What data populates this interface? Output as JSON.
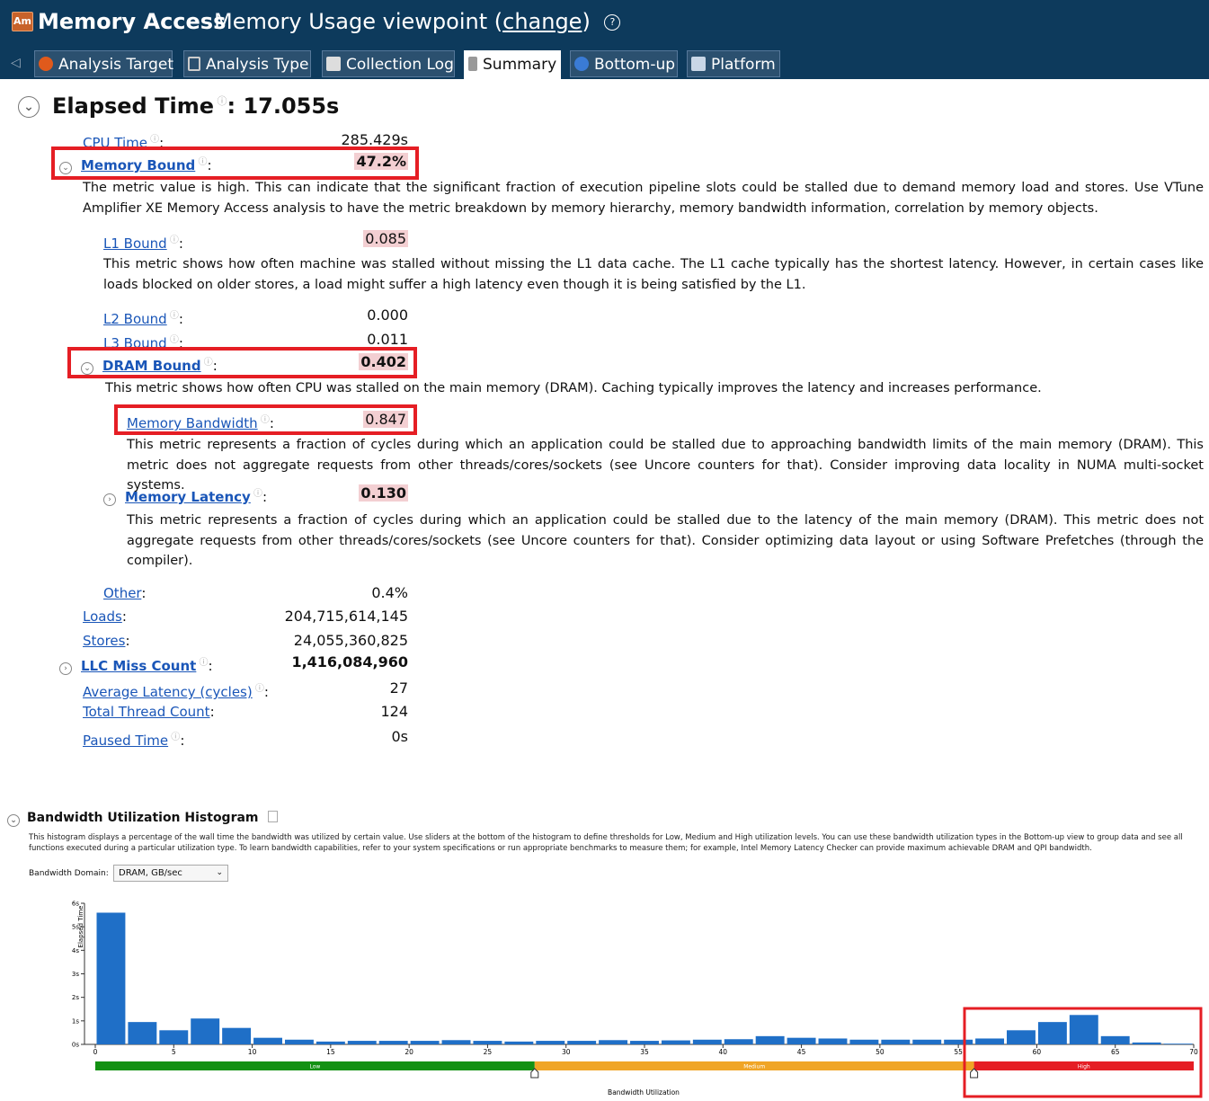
{
  "header": {
    "app_badge": "Am",
    "title": "Memory Access",
    "viewpoint": "Memory Usage viewpoint",
    "change_link": "change",
    "help": "?"
  },
  "tabs": [
    {
      "label": "Analysis Target",
      "icon": "target-icon",
      "active": false
    },
    {
      "label": "Analysis Type",
      "icon": "analysis-type-icon",
      "active": false
    },
    {
      "label": "Collection Log",
      "icon": "log-icon",
      "active": false
    },
    {
      "label": "Summary",
      "icon": "summary-icon",
      "active": true
    },
    {
      "label": "Bottom-up",
      "icon": "bottom-up-icon",
      "active": false
    },
    {
      "label": "Platform",
      "icon": "platform-icon",
      "active": false
    }
  ],
  "summary": {
    "elapsed_label": "Elapsed Time",
    "elapsed_value": ": 17.055s",
    "metrics": {
      "cpu_time": {
        "label": "CPU Time",
        "value": "285.429s"
      },
      "memory_bound": {
        "label": "Memory Bound",
        "value": "47.2%",
        "desc": "The metric value is high. This can indicate that the significant fraction of execution pipeline slots could be stalled due to demand memory load and stores. Use VTune Amplifier XE Memory Access analysis to have the metric breakdown by memory hierarchy, memory bandwidth information, correlation by memory objects."
      },
      "l1_bound": {
        "label": "L1 Bound",
        "value": "0.085",
        "desc": "This metric shows how often machine was stalled without missing the L1 data cache. The L1 cache typically has the shortest latency. However, in certain cases like loads blocked on older stores, a load might suffer a high latency even though it is being satisfied by the L1."
      },
      "l2_bound": {
        "label": "L2 Bound",
        "value": "0.000"
      },
      "l3_bound": {
        "label": "L3 Bound",
        "value": "0.011"
      },
      "dram_bound": {
        "label": "DRAM Bound",
        "value": "0.402",
        "desc": "This metric shows how often CPU was stalled on the main memory (DRAM). Caching typically improves the latency and increases performance."
      },
      "memory_bandwidth": {
        "label": "Memory Bandwidth",
        "value": "0.847",
        "desc": "This metric represents a fraction of cycles during which an application could be stalled due to approaching bandwidth limits of the main memory (DRAM). This metric does not aggregate requests from other threads/cores/sockets (see Uncore counters for that). Consider improving data locality in NUMA multi-socket systems."
      },
      "memory_latency": {
        "label": "Memory Latency",
        "value": "0.130",
        "desc": "This metric represents a fraction of cycles during which an application could be stalled due to the latency of the main memory (DRAM). This metric does not aggregate requests from other threads/cores/sockets (see Uncore counters for that). Consider optimizing data layout or using Software Prefetches (through the compiler)."
      },
      "other": {
        "label": "Other",
        "value": "0.4%"
      },
      "loads": {
        "label": "Loads",
        "value": "204,715,614,145"
      },
      "stores": {
        "label": "Stores",
        "value": "24,055,360,825"
      },
      "llc_miss": {
        "label": "LLC Miss Count",
        "value": "1,416,084,960"
      },
      "avg_latency": {
        "label": "Average Latency (cycles)",
        "value": "27"
      },
      "thread_count": {
        "label": "Total Thread Count",
        "value": "124"
      },
      "paused_time": {
        "label": "Paused Time",
        "value": "0s"
      }
    }
  },
  "histogram": {
    "title": "Bandwidth Utilization Histogram",
    "description": "This histogram displays a percentage of the wall time the bandwidth was utilized by certain value. Use sliders at the bottom of the histogram to define thresholds for Low, Medium and High utilization levels. You can use these bandwidth utilization types in the Bottom-up view to group data and see all functions executed during a particular utilization type. To learn bandwidth capabilities, refer to your system specifications or run appropriate benchmarks to measure them; for example, Intel Memory Latency Checker can provide maximum achievable DRAM and QPI bandwidth.",
    "domain_label": "Bandwidth Domain:",
    "domain_value": "DRAM, GB/sec"
  },
  "chart_data": {
    "type": "bar",
    "xlabel": "Bandwidth Utilization",
    "ylabel": "Elapsed Time",
    "xlim": [
      0,
      70
    ],
    "ylim": [
      0,
      6
    ],
    "x_ticks": [
      0,
      5,
      10,
      15,
      20,
      25,
      30,
      35,
      40,
      45,
      50,
      55,
      60,
      65,
      70
    ],
    "y_ticks": [
      "0s",
      "1s",
      "2s",
      "3s",
      "4s",
      "5s",
      "6s"
    ],
    "bin_width": 2,
    "x": [
      1,
      3,
      5,
      7,
      9,
      11,
      13,
      15,
      17,
      19,
      21,
      23,
      25,
      27,
      29,
      31,
      33,
      35,
      37,
      39,
      41,
      43,
      45,
      47,
      49,
      51,
      53,
      55,
      57,
      59,
      61,
      63,
      65,
      67,
      69
    ],
    "values": [
      5.6,
      0.95,
      0.6,
      1.1,
      0.7,
      0.28,
      0.2,
      0.12,
      0.15,
      0.15,
      0.15,
      0.18,
      0.15,
      0.12,
      0.15,
      0.15,
      0.18,
      0.15,
      0.17,
      0.2,
      0.22,
      0.35,
      0.28,
      0.25,
      0.2,
      0.2,
      0.2,
      0.2,
      0.25,
      0.6,
      0.95,
      1.25,
      0.35,
      0.08,
      0.03
    ],
    "bar_color": "#1f6fc7",
    "thresholds": [
      {
        "name": "Low",
        "from": 0,
        "to": 28,
        "color": "#139113"
      },
      {
        "name": "Medium",
        "from": 28,
        "to": 56,
        "color": "#f0a526"
      },
      {
        "name": "High",
        "from": 56,
        "to": 70,
        "color": "#e51e24"
      }
    ]
  }
}
